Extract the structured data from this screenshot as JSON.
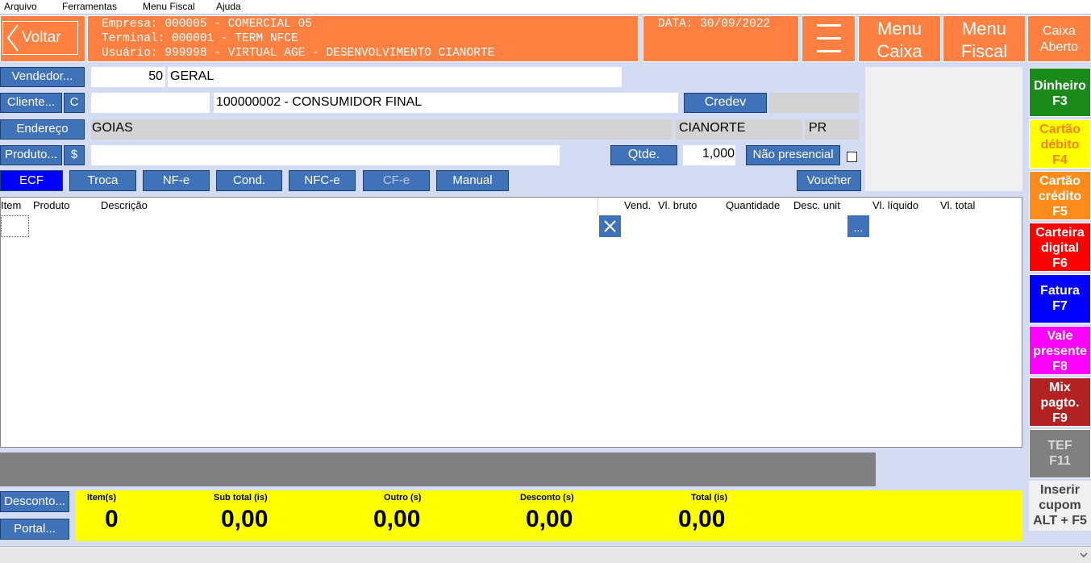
{
  "menu": {
    "items": [
      "Arquivo",
      "Ferramentas",
      "Menu Fiscal",
      "Ajuda"
    ]
  },
  "header": {
    "back_label": "Voltar",
    "empresa": "Empresa: 000005 - COMERCIAL 05",
    "terminal": "Terminal: 000001 - TERM NFCE",
    "usuario": "Usuário: 999998 - VIRTUAL AGE - DESENVOLVIMENTO CIANORTE",
    "date": "DATA: 30/09/2022",
    "menu_caixa_1": "Menu",
    "menu_caixa_2": "Caixa",
    "menu_fiscal_1": "Menu",
    "menu_fiscal_2": "Fiscal",
    "caixa_status_1": "Caixa",
    "caixa_status_2": "Aberto"
  },
  "form": {
    "vendedor_label": "Vendedor...",
    "vendedor_code": "50",
    "vendedor_name": "GERAL",
    "cliente_label": "Cliente...",
    "cliente_c": "C",
    "cliente_code": "",
    "cliente_name": "100000002 - CONSUMIDOR FINAL",
    "credev_label": "Credev",
    "endereco_label": "Endereço",
    "endereco_estado": "GOIAS",
    "endereco_cidade": "CIANORTE",
    "endereco_uf": "PR",
    "produto_label": "Produto...",
    "produto_dollar": "$",
    "produto_value": "",
    "qtde_label": "Qtde.",
    "qtde_value": "1,000",
    "nao_presencial_label": "Não presencial"
  },
  "tabs": [
    "ECF",
    "Troca",
    "NF-e",
    "Cond.",
    "NFC-e",
    "CF-e",
    "Manual"
  ],
  "voucher_label": "Voucher",
  "grid": {
    "columns": [
      "Item",
      "Produto",
      "Descrição",
      "Vend.",
      "Vl. bruto",
      "Quantidade",
      "Desc. unit",
      "Vl. líquido",
      "Vl. total"
    ],
    "delete_label": "X",
    "more_label": "..."
  },
  "payments": [
    {
      "l1": "Dinheiro",
      "l2": "F3",
      "l3": "",
      "color": "#1a8a1a"
    },
    {
      "l1": "Cartão",
      "l2": "débito",
      "l3": "F4",
      "color": "#ffff00"
    },
    {
      "l1": "Cartão",
      "l2": "crédito",
      "l3": "F5",
      "color": "#ff8c1a"
    },
    {
      "l1": "Carteira",
      "l2": "digital",
      "l3": "F6",
      "color": "#ff0000"
    },
    {
      "l1": "Fatura",
      "l2": "F7",
      "l3": "",
      "color": "#0000ff"
    },
    {
      "l1": "Vale",
      "l2": "presente",
      "l3": "F8",
      "color": "#ff00ff"
    },
    {
      "l1": "Mix",
      "l2": "pagto.",
      "l3": "F9",
      "color": "#b22222"
    },
    {
      "l1": "TEF",
      "l2": "F11",
      "l3": "",
      "color": "#808080"
    }
  ],
  "inserir_cupom": {
    "l1": "Inserir",
    "l2": "cupom",
    "l3": "ALT + F5"
  },
  "bottom": {
    "desconto_label": "Desconto...",
    "portal_label": "Portal..."
  },
  "totals": {
    "items_label": "Item(s)",
    "items_value": "0",
    "subtotal_label": "Sub total (is)",
    "subtotal_value": "0,00",
    "outro_label": "Outro (s)",
    "outro_value": "0,00",
    "desconto_label": "Desconto (s)",
    "desconto_value": "0,00",
    "total_label": "Total (is)",
    "total_value": "0,00"
  }
}
